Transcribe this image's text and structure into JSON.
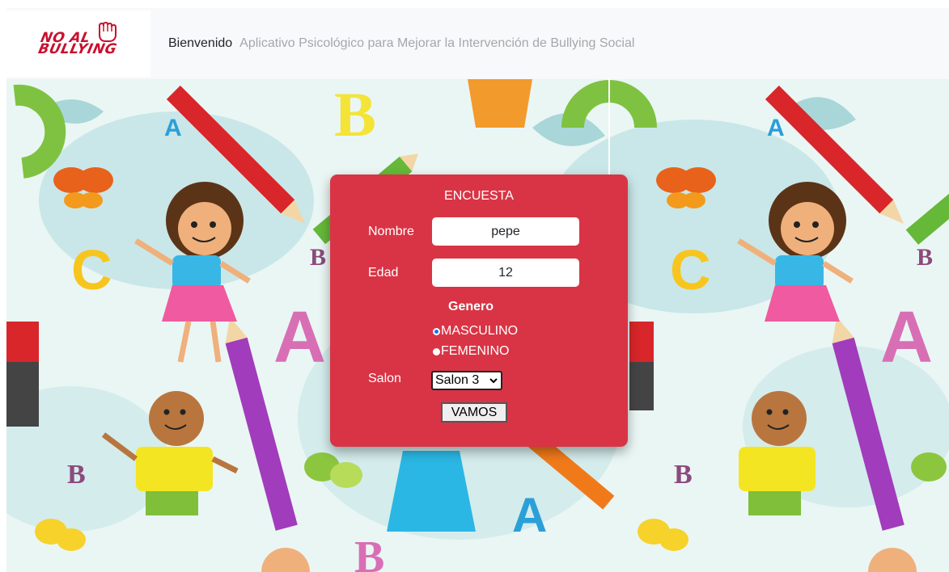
{
  "navbar": {
    "logo_text": "NO AL\nBULLYING",
    "brand": "Bienvenido",
    "subtitle": "Aplicativo Psicológico para Mejorar la Intervención de Bullying Social"
  },
  "form": {
    "title": "ENCUESTA",
    "nombre_label": "Nombre",
    "nombre_value": "pepe",
    "edad_label": "Edad",
    "edad_value": "12",
    "genero_label": "Genero",
    "options": [
      "MASCULINO",
      "FEMENINO"
    ],
    "selected_option": "MASCULINO",
    "salon_label": "Salon",
    "salon_value": "Salon 3",
    "submit_label": "VAMOS"
  },
  "colors": {
    "card": "#d93445",
    "navbar": "#f8f9fa",
    "logo": "#c8102e"
  }
}
